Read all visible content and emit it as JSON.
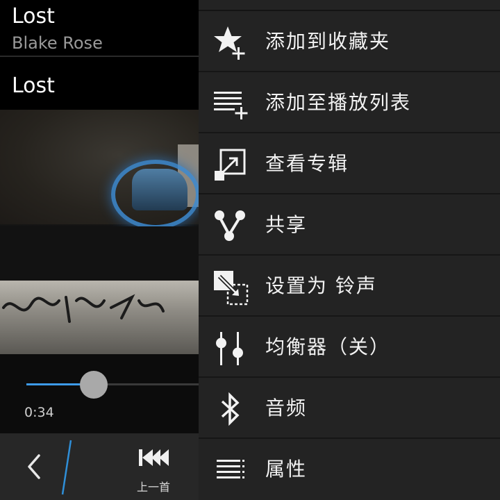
{
  "player": {
    "title": "Lost",
    "artist": "Blake Rose",
    "song_name": "Lost",
    "elapsed": "0:34",
    "progress_fraction": 0.39,
    "accent_color": "#3d9be9",
    "actions": {
      "back_icon": "chevron-left-icon",
      "prev_icon": "skip-previous-icon",
      "prev_label": "上一首"
    }
  },
  "menu": {
    "items": [
      {
        "label": "添加到收藏夹",
        "icon": "star-plus-icon"
      },
      {
        "label": "添加至播放列表",
        "icon": "playlist-add-icon"
      },
      {
        "label": "查看专辑",
        "icon": "open-album-icon"
      },
      {
        "label": "共享",
        "icon": "share-icon"
      },
      {
        "label": "设置为 铃声",
        "icon": "set-ringtone-icon"
      },
      {
        "label": "均衡器（关）",
        "icon": "equalizer-icon"
      },
      {
        "label": "音频",
        "icon": "bluetooth-icon"
      },
      {
        "label": "属性",
        "icon": "properties-list-icon"
      }
    ]
  }
}
